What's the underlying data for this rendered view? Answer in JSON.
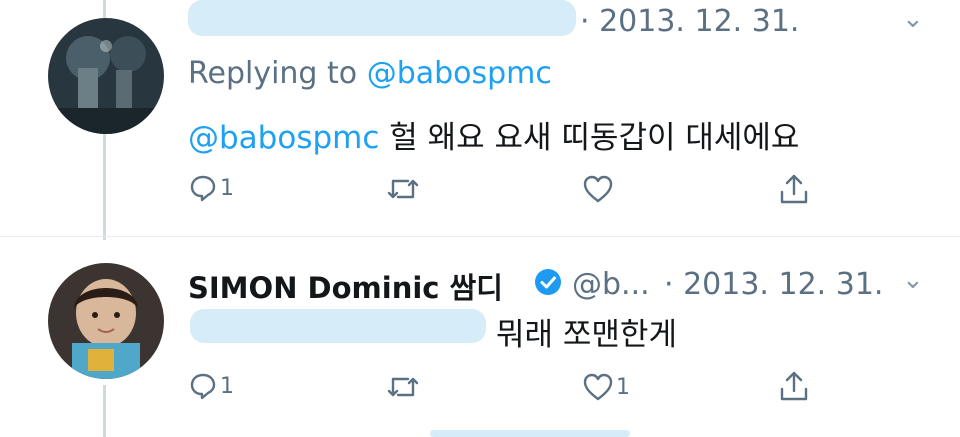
{
  "tweet1": {
    "date": "· 2013. 12. 31.",
    "replying_prefix": "Replying to",
    "replying_handle": "@babospmc",
    "text_mention": "@babospmc",
    "text": "헐 왜요 요새 띠동갑이 대세에요",
    "reply_count": "1",
    "retweet_count": "",
    "like_count": ""
  },
  "tweet2": {
    "name": "SIMON Dominic 쌈디",
    "handle": "@b...",
    "date": "· 2013. 12. 31.",
    "text": "뭐래 쪼맨한게",
    "reply_count": "1",
    "retweet_count": "",
    "like_count": "1"
  },
  "icons": {
    "more": "chevron-down-icon",
    "reply": "reply-icon",
    "retweet": "retweet-icon",
    "like": "heart-icon",
    "share": "share-icon",
    "verified": "verified-badge-icon"
  },
  "colors": {
    "link": "#1da1f2",
    "muted": "#5b7083",
    "verified": "#1d9bf0"
  }
}
